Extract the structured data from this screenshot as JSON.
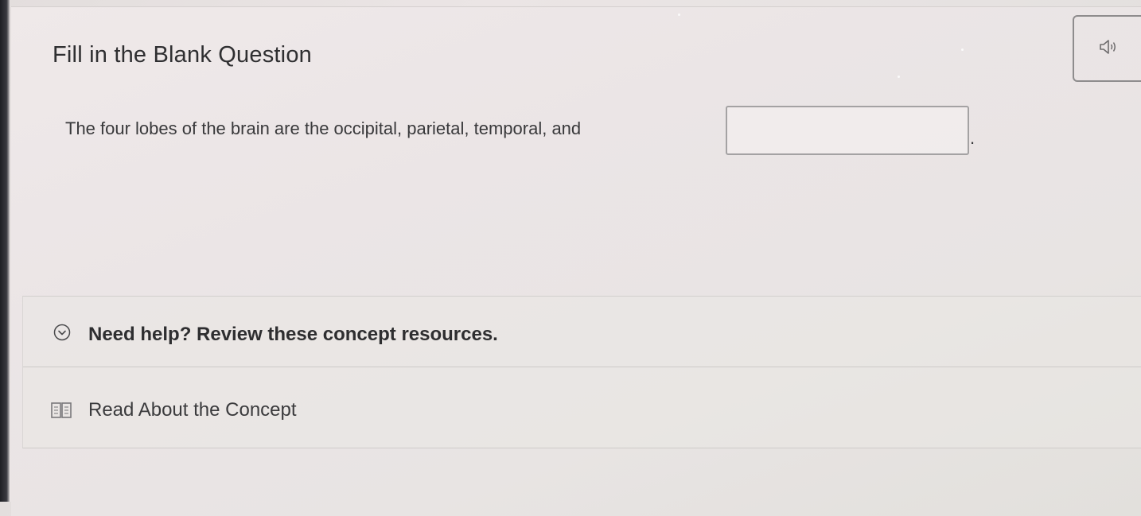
{
  "question": {
    "heading": "Fill in the Blank Question",
    "audio_icon": "speaker-icon",
    "prompt_text": "The four lobes of the brain are the occipital, parietal, temporal, and",
    "blank_value": "",
    "trailing_punctuation": "."
  },
  "help": {
    "toggle_icon": "chevron-down-circle-icon",
    "header_text": "Need help? Review these concept resources.",
    "resources": [
      {
        "icon": "book-icon",
        "label": "Read About the Concept"
      }
    ]
  },
  "colors": {
    "background": "#e8e3e3",
    "text": "#2f2f31",
    "border": "#a4a2a3"
  }
}
